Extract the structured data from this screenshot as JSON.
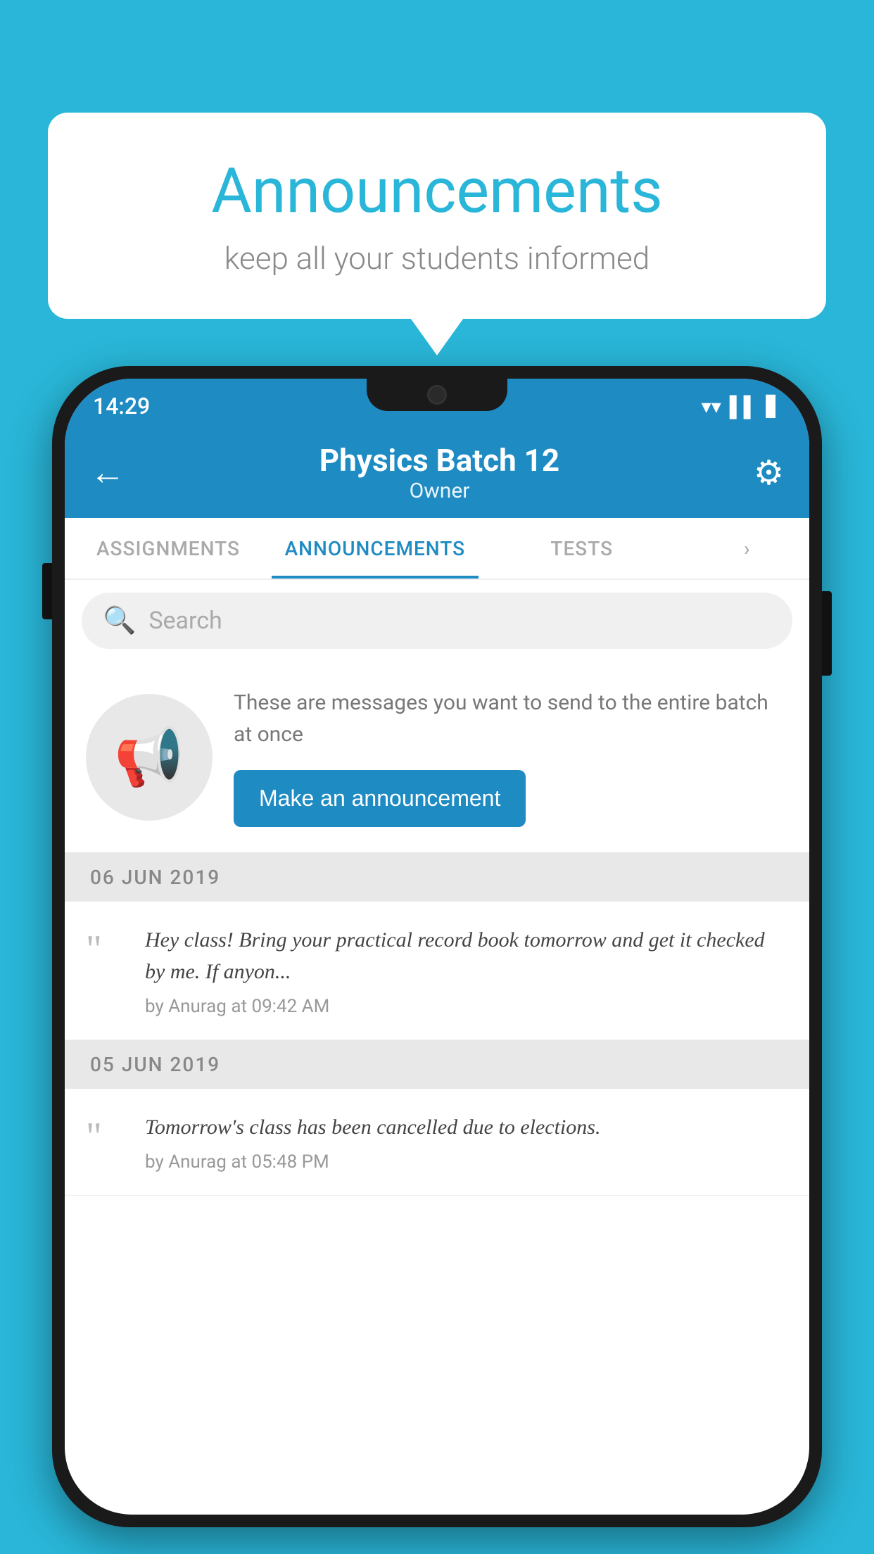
{
  "background_color": "#29b6d8",
  "speech_bubble": {
    "title": "Announcements",
    "subtitle": "keep all your students informed"
  },
  "phone": {
    "status_bar": {
      "time": "14:29",
      "icons": [
        "wifi",
        "signal",
        "battery"
      ]
    },
    "header": {
      "title": "Physics Batch 12",
      "subtitle": "Owner",
      "back_label": "←",
      "gear_label": "⚙"
    },
    "tabs": [
      {
        "label": "ASSIGNMENTS",
        "active": false
      },
      {
        "label": "ANNOUNCEMENTS",
        "active": true
      },
      {
        "label": "TESTS",
        "active": false
      },
      {
        "label": "",
        "active": false,
        "partial": true
      }
    ],
    "search": {
      "placeholder": "Search"
    },
    "promo": {
      "description": "These are messages you want to send to the entire batch at once",
      "button_label": "Make an announcement"
    },
    "announcements": [
      {
        "date": "06  JUN  2019",
        "items": [
          {
            "text": "Hey class! Bring your practical record book tomorrow and get it checked by me. If anyon...",
            "author": "by Anurag at 09:42 AM"
          }
        ]
      },
      {
        "date": "05  JUN  2019",
        "items": [
          {
            "text": "Tomorrow's class has been cancelled due to elections.",
            "author": "by Anurag at 05:48 PM"
          }
        ]
      }
    ]
  }
}
